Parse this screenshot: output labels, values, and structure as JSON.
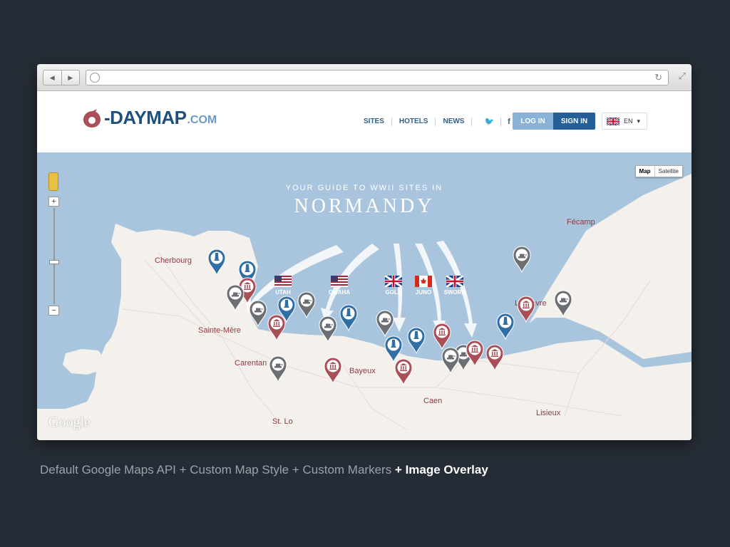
{
  "browser": {
    "back_icon": "back-arrow-icon",
    "forward_icon": "forward-arrow-icon",
    "url": "",
    "reload_icon": "reload-icon"
  },
  "site": {
    "logo_main": "-DAYMAP",
    "logo_com": ".COM",
    "nav": [
      "SITES",
      "HOTELS",
      "NEWS"
    ],
    "login_label": "LOG IN",
    "signin_label": "SIGN IN",
    "lang_label": "EN",
    "colors": {
      "brand": "#245f97",
      "accent": "#8e3a42",
      "water": "#a9c5dd",
      "land": "#f4f1ec"
    }
  },
  "map": {
    "type_map": "Map",
    "type_satellite": "Satellite",
    "headline_sub": "YOUR GUIDE TO WWII SITES IN",
    "headline": "NORMANDY",
    "google_logo": "Google",
    "cities": [
      {
        "name": "Cherbourg"
      },
      {
        "name": "Sainte-Mère"
      },
      {
        "name": "Carentan"
      },
      {
        "name": "Bayeux"
      },
      {
        "name": "Caen"
      },
      {
        "name": "St. Lo"
      },
      {
        "name": "Le Havre"
      },
      {
        "name": "Fécamp"
      },
      {
        "name": "Lisieux"
      }
    ],
    "beaches": [
      {
        "label": "UTAH",
        "flag": "us"
      },
      {
        "label": "OMAHA",
        "flag": "us"
      },
      {
        "label": "GOLD",
        "flag": "uk"
      },
      {
        "label": "JUNO",
        "flag": "ca"
      },
      {
        "label": "SWORD",
        "flag": "uk"
      }
    ],
    "markers": [
      {
        "kind": "monument",
        "color": "#2f6fa6"
      },
      {
        "kind": "monument",
        "color": "#2f6fa6"
      },
      {
        "kind": "museum",
        "color": "#a94f57"
      },
      {
        "kind": "tank",
        "color": "#6b6e72"
      },
      {
        "kind": "tank",
        "color": "#6b6e72"
      },
      {
        "kind": "museum",
        "color": "#a94f57"
      },
      {
        "kind": "monument",
        "color": "#2f6fa6"
      },
      {
        "kind": "tank",
        "color": "#6b6e72"
      },
      {
        "kind": "tank",
        "color": "#6b6e72"
      },
      {
        "kind": "monument",
        "color": "#2f6fa6"
      },
      {
        "kind": "tank",
        "color": "#6b6e72"
      },
      {
        "kind": "monument",
        "color": "#2f6fa6"
      },
      {
        "kind": "monument",
        "color": "#2f6fa6"
      },
      {
        "kind": "museum",
        "color": "#a94f57"
      },
      {
        "kind": "museum",
        "color": "#a94f57"
      },
      {
        "kind": "tank",
        "color": "#6b6e72"
      },
      {
        "kind": "tank",
        "color": "#6b6e72"
      },
      {
        "kind": "museum",
        "color": "#a94f57"
      },
      {
        "kind": "museum",
        "color": "#a94f57"
      },
      {
        "kind": "tank",
        "color": "#6b6e72"
      },
      {
        "kind": "museum",
        "color": "#a94f57"
      },
      {
        "kind": "monument",
        "color": "#2f6fa6"
      },
      {
        "kind": "tank",
        "color": "#6b6e72"
      },
      {
        "kind": "museum",
        "color": "#a94f57"
      },
      {
        "kind": "tank",
        "color": "#6b6e72"
      }
    ]
  },
  "caption": {
    "normal": "Default Google Maps API  + Custom Map Style + Custom Markers",
    "strong": " + Image Overlay"
  }
}
